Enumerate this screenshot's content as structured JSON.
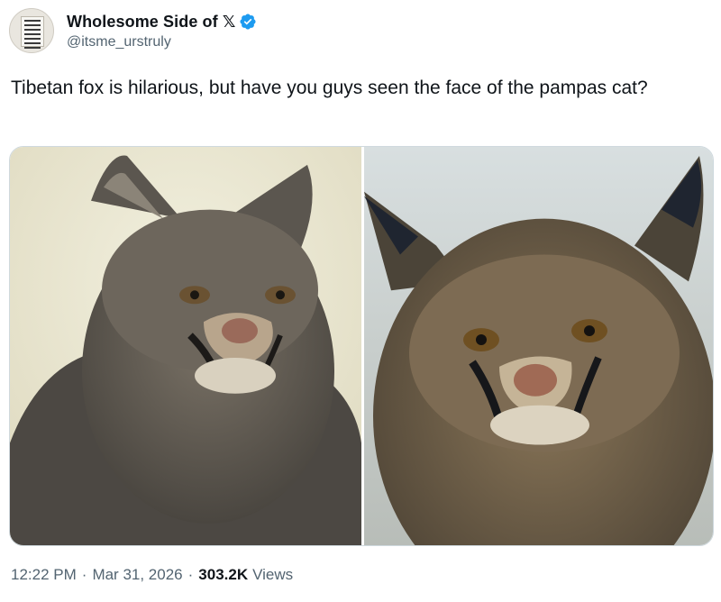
{
  "author": {
    "display_name": "Wholesome Side of 𝕏",
    "handle": "@itsme_urstruly",
    "avatar_icon": "sign-board-avatar",
    "verified_icon": "verified-badge-icon",
    "verified_color": "#1d9bf0"
  },
  "tweet": {
    "text": "Tibetan fox is hilarious, but have you guys seen the face of the pampas cat?"
  },
  "media": {
    "count": 2
  },
  "meta": {
    "time": "12:22 PM",
    "separator": "·",
    "date": "Mar 31, 2026",
    "views_count": "303.2K",
    "views_label": "Views"
  }
}
